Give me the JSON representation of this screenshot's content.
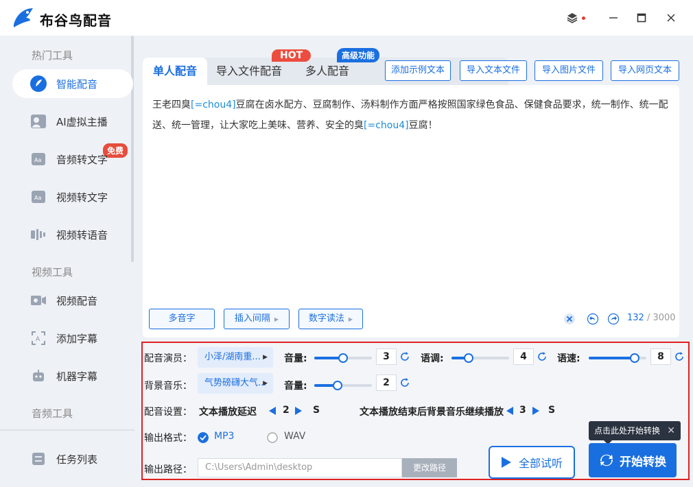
{
  "app": {
    "title": "布谷鸟配音"
  },
  "window": {
    "skin_icon": "layers-icon",
    "minimize": "—",
    "maximize": "▢",
    "close": "✕"
  },
  "sidebar": {
    "sections": {
      "hot": "热门工具",
      "video": "视频工具",
      "audio": "音频工具"
    },
    "items": [
      {
        "label": "智能配音",
        "icon": "smart-dub-icon",
        "active": true
      },
      {
        "label": "AI虚拟主播",
        "icon": "avatar-icon",
        "badge": "免费"
      },
      {
        "label": "音频转文字",
        "icon": "audio-to-text-icon"
      },
      {
        "label": "视频转文字",
        "icon": "video-to-text-icon"
      },
      {
        "label": "视频转语音",
        "icon": "video-to-voice-icon"
      },
      {
        "label": "视频配音",
        "icon": "video-dub-icon"
      },
      {
        "label": "添加字幕",
        "icon": "add-subtitle-icon"
      },
      {
        "label": "机器字幕",
        "icon": "robot-subtitle-icon"
      }
    ],
    "task_list": "任务列表"
  },
  "tabs": [
    {
      "label": "单人配音",
      "active": true
    },
    {
      "label": "导入文件配音",
      "badge": "HOT"
    },
    {
      "label": "多人配音",
      "badge": "高级功能"
    }
  ],
  "toolbar": {
    "add_example": "添加示例文本",
    "import_text": "导入文本文件",
    "import_image": "导入图片文件",
    "import_web": "导入网页文本"
  },
  "editor": {
    "text_parts": [
      "王老四臭",
      "[=chou4]",
      "豆腐在卤水配方、豆腐制作、汤料制作方面严格按照国家绿色食品、保健食品要求，统一制作、统一配送、统一管理，让大家吃上美味、营养、安全的臭",
      "[=chou4]",
      "豆腐！"
    ],
    "buttons": {
      "polyphone": "多音字",
      "insert_pause": "插入间隔",
      "number_reading": "数字读法"
    },
    "char_count": "132",
    "char_max": "/ 3000"
  },
  "settings": {
    "voice_label": "配音演员：",
    "voice_value": "小泽/湖南重...",
    "volume_label": "音量:",
    "volume_value": "3",
    "volume_level": 0.5,
    "pitch_label": "语调:",
    "pitch_value": "4",
    "pitch_level": 0.3,
    "speed_label": "语速:",
    "speed_value": "8",
    "speed_level": 0.8,
    "bgm_label": "背景音乐：",
    "bgm_value": "气势磅礴大气...",
    "bgm_volume_label": "音量:",
    "bgm_volume_value": "2",
    "bgm_volume_level": 0.4,
    "dub_label": "配音设置：",
    "delay_label": "文本播放延迟",
    "delay_value": "2",
    "delay_unit": "S",
    "after_label": "文本播放结束后背景音乐继续播放",
    "after_value": "3",
    "after_unit": "S",
    "format_label": "输出格式：",
    "format_mp3": "MP3",
    "format_wav": "WAV",
    "format_selected": "MP3",
    "path_label": "输出路径：",
    "path_value": "C:\\Users\\Admin\\desktop",
    "change_path": "更改路径",
    "preview_all": "全部试听",
    "start": "开始转换",
    "tooltip": "点击此处开始转换"
  },
  "colors": {
    "accent": "#1a6fe0",
    "highlight_border": "#e02020",
    "hot": "#ec4d3e"
  }
}
